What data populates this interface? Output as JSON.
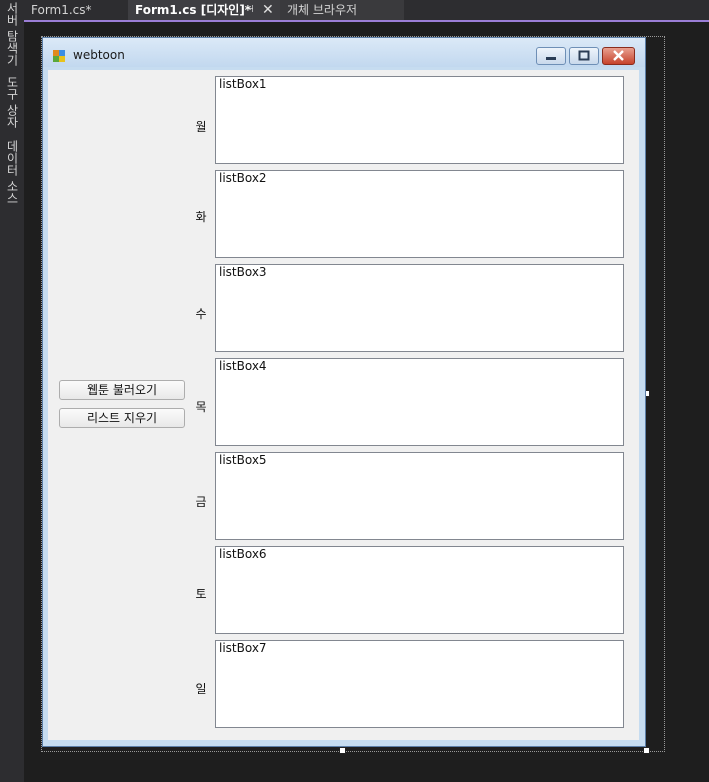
{
  "side_panel": {
    "tabs": [
      "서버 탐색기",
      "도구 상자",
      "데이터 소스"
    ]
  },
  "tabs": [
    {
      "label": "Form1.cs*"
    },
    {
      "label": "Form1.cs [디자인]*",
      "pin_icon": "pin-icon",
      "close_icon": "close-icon"
    },
    {
      "label": "개체 브라우저"
    }
  ],
  "form": {
    "title": "webtoon",
    "buttons": {
      "load_label": "웹툰 불러오기",
      "clear_label": "리스트 지우기"
    },
    "days": [
      {
        "label": "월",
        "listbox": "listBox1"
      },
      {
        "label": "화",
        "listbox": "listBox2"
      },
      {
        "label": "수",
        "listbox": "listBox3"
      },
      {
        "label": "목",
        "listbox": "listBox4"
      },
      {
        "label": "금",
        "listbox": "listBox5"
      },
      {
        "label": "토",
        "listbox": "listBox6"
      },
      {
        "label": "일",
        "listbox": "listBox7"
      }
    ]
  },
  "colors": {
    "accent": "#9b7ed6",
    "form_border": "#5c7fa8",
    "close_button": "#c7432c"
  }
}
